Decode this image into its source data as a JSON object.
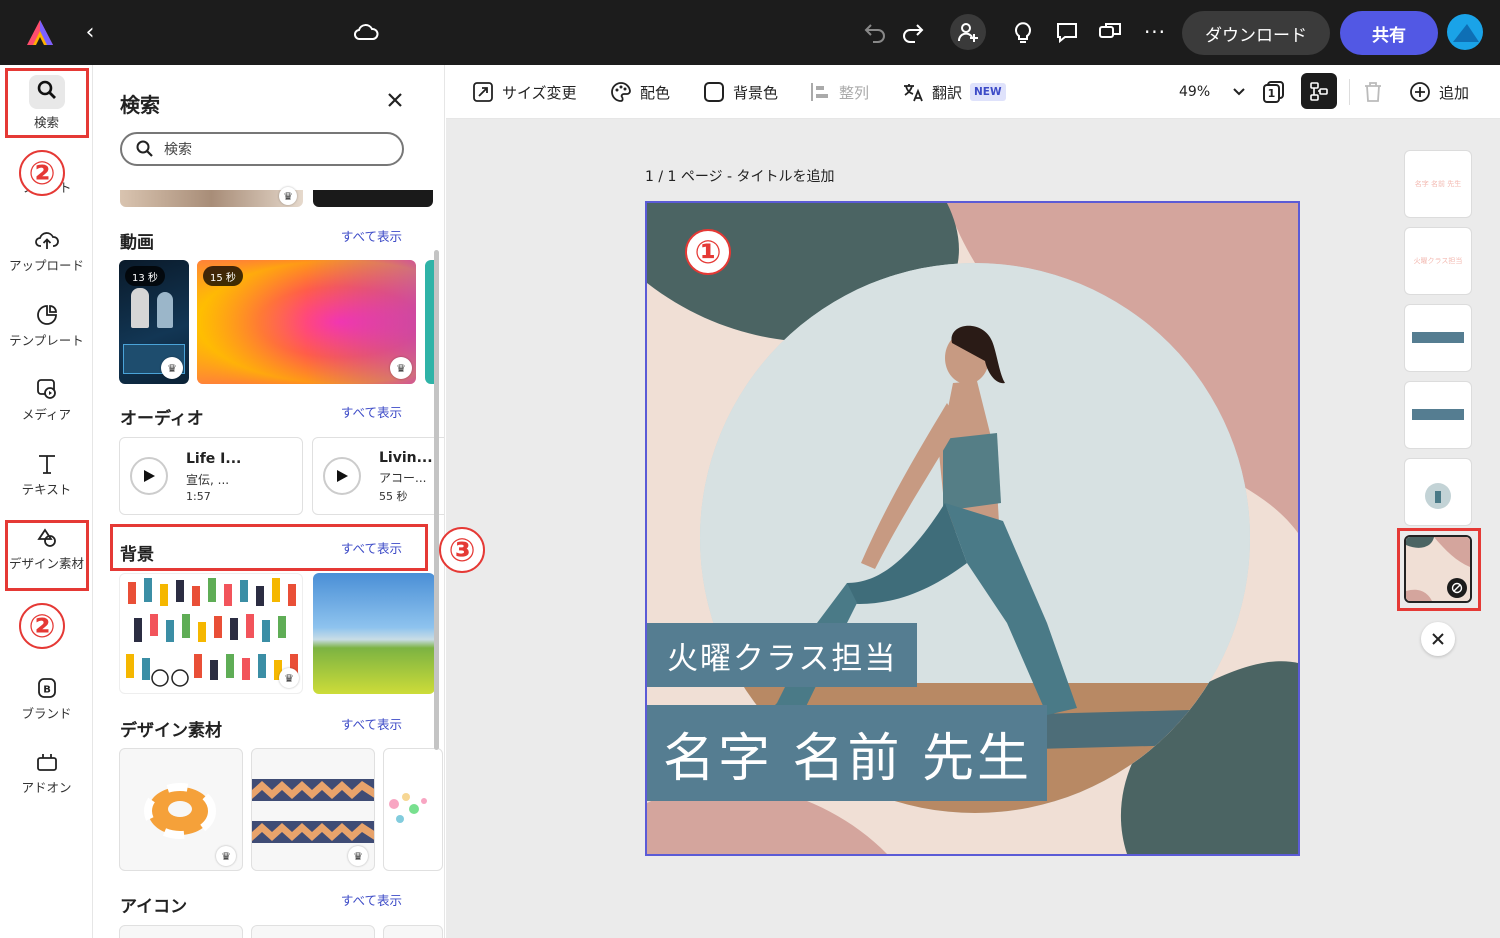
{
  "topbar": {
    "download_label": "ダウンロード",
    "share_label": "共有"
  },
  "rail": {
    "items": [
      {
        "label": "検索"
      },
      {
        "label": "フォント"
      },
      {
        "label": "アップロード"
      },
      {
        "label": "テンプレート"
      },
      {
        "label": "メディア"
      },
      {
        "label": "テキスト"
      },
      {
        "label": "デザイン素材"
      },
      {
        "label": "ブランド"
      },
      {
        "label": "アドオン"
      }
    ]
  },
  "panel": {
    "title": "検索",
    "search_placeholder": "検索",
    "see_all": "すべて表示",
    "sections": {
      "video": "動画",
      "audio": "オーディオ",
      "background": "背景",
      "design": "デザイン素材",
      "icons": "アイコン"
    },
    "videos": [
      {
        "duration": "13 秒"
      },
      {
        "duration": "15 秒"
      }
    ],
    "audio": [
      {
        "title": "Life I...",
        "subtitle": "宣伝, ...",
        "time": "1:57"
      },
      {
        "title": "Livin...",
        "subtitle": "アコー...",
        "time": "55 秒"
      }
    ]
  },
  "toolbar": {
    "resize": "サイズ変更",
    "color": "配色",
    "bg_color": "背景色",
    "align": "整列",
    "translate": "翻訳",
    "new_badge": "NEW",
    "zoom": "49%",
    "page_count": "1",
    "add": "追加"
  },
  "canvas": {
    "page_label": "1 / 1 ページ - タイトルを追加",
    "subtitle": "火曜クラス担当",
    "name": "名字 名前 先生"
  },
  "layers": {
    "thumb1_text": "名字 名前 先生",
    "thumb2_text": "火曜クラス担当"
  },
  "annotations": {
    "one": "①",
    "two": "②",
    "three": "③"
  },
  "colors": {
    "accent": "#5b5bd6",
    "share": "#5258e4",
    "annotation": "#e53935",
    "label_bg": "#557d91",
    "dark_blob": "#4b6463",
    "pink_blob": "#d4a59d"
  }
}
